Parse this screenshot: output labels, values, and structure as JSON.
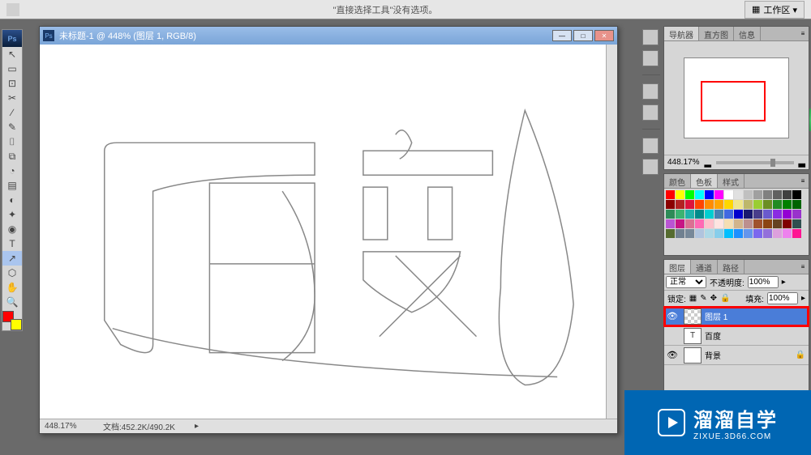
{
  "options_bar": {
    "text": "\"直接选择工具\"没有选项。",
    "workspace_label": "工作区 ▾"
  },
  "document": {
    "title": "未标题-1 @ 448% (图层 1, RGB/8)",
    "zoom": "448.17%",
    "doc_info": "文档:452.2K/490.2K"
  },
  "panels": {
    "navigator": {
      "tabs": [
        "导航器",
        "直方图",
        "信息"
      ],
      "zoom": "448.17%"
    },
    "swatches": {
      "tabs": [
        "颜色",
        "色板",
        "样式"
      ]
    },
    "layers": {
      "tabs": [
        "图层",
        "通道",
        "路径"
      ],
      "blend_mode": "正常",
      "opacity_label": "不透明度:",
      "opacity_value": "100%",
      "lock_label": "锁定:",
      "fill_label": "填充:",
      "fill_value": "100%",
      "items": [
        {
          "name": "图层 1",
          "thumb": "checker",
          "active": true,
          "highlighted": true,
          "eye": true
        },
        {
          "name": "百度",
          "thumb": "T",
          "active": false,
          "eye": false
        },
        {
          "name": "背景",
          "thumb": "white",
          "active": false,
          "eye": true,
          "locked": true
        }
      ]
    }
  },
  "watermark": {
    "cn": "溜溜自学",
    "en": "ZIXUE.3D66.COM"
  },
  "swatch_colors": [
    "#ff0000",
    "#ffff00",
    "#00ff00",
    "#00ffff",
    "#0000ff",
    "#ff00ff",
    "#ffffff",
    "#e0e0e0",
    "#c0c0c0",
    "#a0a0a0",
    "#808080",
    "#606060",
    "#404040",
    "#000000",
    "#8b0000",
    "#b22222",
    "#dc143c",
    "#ff4500",
    "#ff8c00",
    "#ffa500",
    "#ffd700",
    "#f0e68c",
    "#bdb76b",
    "#9acd32",
    "#6b8e23",
    "#228b22",
    "#008000",
    "#006400",
    "#2e8b57",
    "#3cb371",
    "#20b2aa",
    "#008b8b",
    "#00ced1",
    "#4682b4",
    "#4169e1",
    "#0000cd",
    "#191970",
    "#483d8b",
    "#6a5acd",
    "#8a2be2",
    "#9400d3",
    "#9932cc",
    "#ba55d3",
    "#c71585",
    "#db7093",
    "#ff69b4",
    "#ffc0cb",
    "#ffe4e1",
    "#f5deb3",
    "#d2b48c",
    "#bc8f8f",
    "#a0522d",
    "#8b4513",
    "#654321",
    "#800000",
    "#2f4f4f",
    "#556b2f",
    "#708090",
    "#778899",
    "#b0c4de",
    "#add8e6",
    "#87ceeb",
    "#00bfff",
    "#1e90ff",
    "#6495ed",
    "#7b68ee",
    "#9370db",
    "#dda0dd",
    "#ee82ee",
    "#ff1493"
  ],
  "tools": [
    "↖",
    "▭",
    "⊡",
    "✂",
    "∕",
    "✎",
    "⌷",
    "⧉",
    "◔",
    "▤",
    "◐",
    "✦",
    "◉",
    "T",
    "↗",
    "⬡",
    "✋",
    "🔍"
  ]
}
